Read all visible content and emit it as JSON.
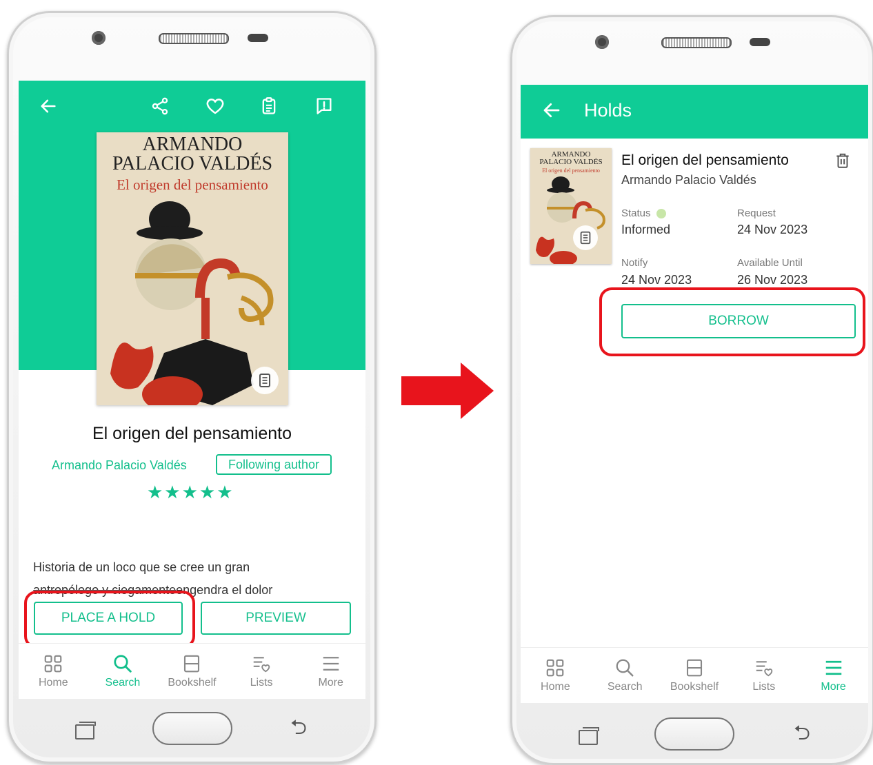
{
  "screen1": {
    "cover": {
      "author_line1": "ARMANDO",
      "author_line2": "PALACIO VALDÉS",
      "title_line": "El origen del pensamiento"
    },
    "title": "El origen del pensamiento",
    "author": "Armando Palacio Valdés",
    "follow_label": "Following author",
    "rating_stars": "★★★★★",
    "description_line1": "Historia de un loco que se cree un gran",
    "description_struck": "antropólogo y ciegamente",
    "description_rest": "engendra el dolor",
    "place_hold_label": "PLACE A HOLD",
    "preview_label": "PREVIEW",
    "nav": [
      {
        "label": "Home"
      },
      {
        "label": "Search"
      },
      {
        "label": "Bookshelf"
      },
      {
        "label": "Lists"
      },
      {
        "label": "More"
      }
    ]
  },
  "screen2": {
    "header_title": "Holds",
    "thumb": {
      "author_line1": "ARMANDO",
      "author_line2": "PALACIO VALDÉS",
      "title_line": "El origen del pensamiento"
    },
    "book_title": "El origen del pensamiento",
    "book_author": "Armando Palacio Valdés",
    "status_label": "Status",
    "status_value": "Informed",
    "request_label": "Request",
    "request_value": "24 Nov 2023",
    "notify_label": "Notify",
    "notify_value": "24 Nov 2023",
    "available_label": "Available Until",
    "available_value": "26 Nov 2023",
    "borrow_label": "BORROW",
    "nav": [
      {
        "label": "Home"
      },
      {
        "label": "Search"
      },
      {
        "label": "Bookshelf"
      },
      {
        "label": "Lists"
      },
      {
        "label": "More"
      }
    ]
  },
  "colors": {
    "accent": "#13bf8c",
    "header": "#0fcc96",
    "highlight": "#e8141c",
    "status_dot": "#c8e6a8"
  }
}
